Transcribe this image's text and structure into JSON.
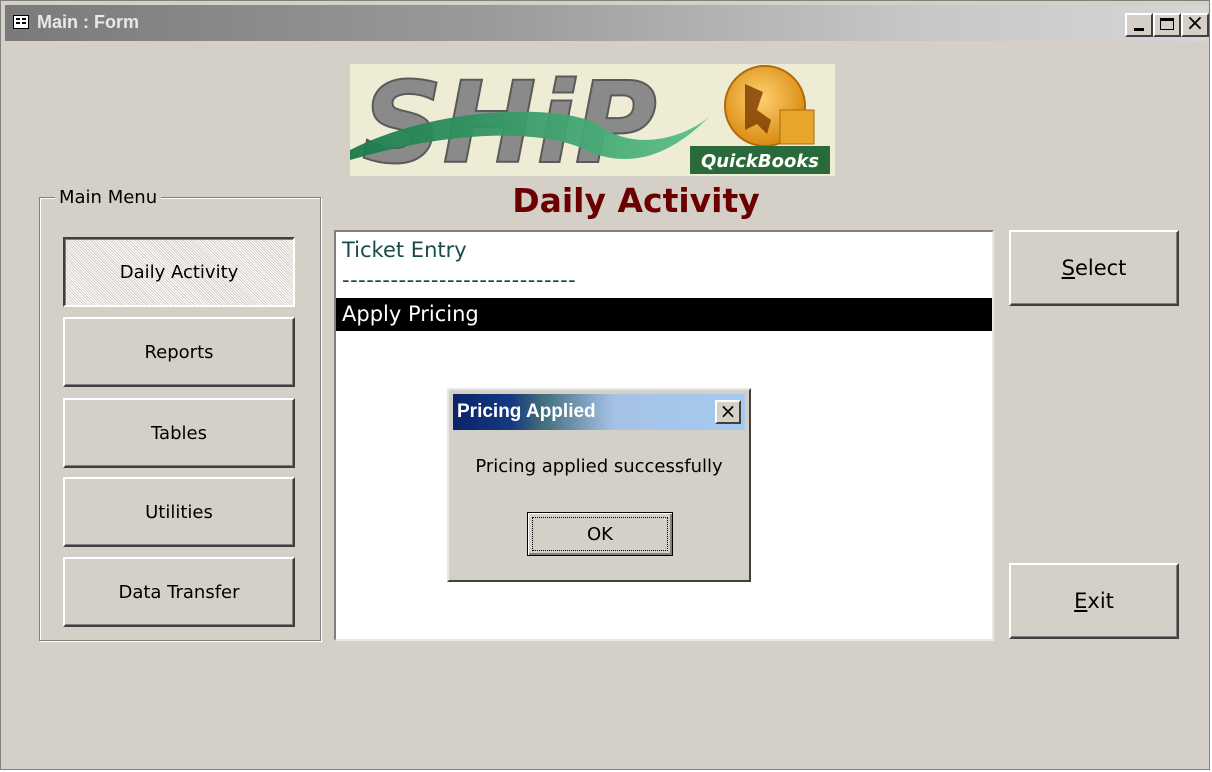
{
  "window": {
    "title": "Main : Form",
    "controls": [
      "minimize-icon",
      "maximize-icon",
      "close-icon"
    ]
  },
  "logo": {
    "wordmark": "SHiP",
    "badge": "QuickBooks"
  },
  "page_title": "Daily Activity",
  "main_menu": {
    "label": "Main Menu",
    "items": [
      {
        "label": "Daily Activity",
        "pressed": true
      },
      {
        "label": "Reports"
      },
      {
        "label": "Tables"
      },
      {
        "label": "Utilities"
      },
      {
        "label": "Data Transfer"
      }
    ]
  },
  "activity_list": {
    "items": [
      {
        "label": "Ticket Entry"
      },
      {
        "label": "-----------------------------"
      },
      {
        "label": "Apply Pricing",
        "selected": true
      }
    ]
  },
  "actions": {
    "select": {
      "mnemonic": "S",
      "rest": "elect"
    },
    "exit": {
      "mnemonic": "E",
      "rest": "xit"
    }
  },
  "dialog": {
    "title": "Pricing Applied",
    "message": "Pricing applied successfully",
    "ok_label": "OK"
  },
  "colors": {
    "face": "#d4d0c8",
    "title_red": "#6b0000",
    "list_text": "#1a4a4a",
    "dialog_title_dark": "#0a246a"
  }
}
